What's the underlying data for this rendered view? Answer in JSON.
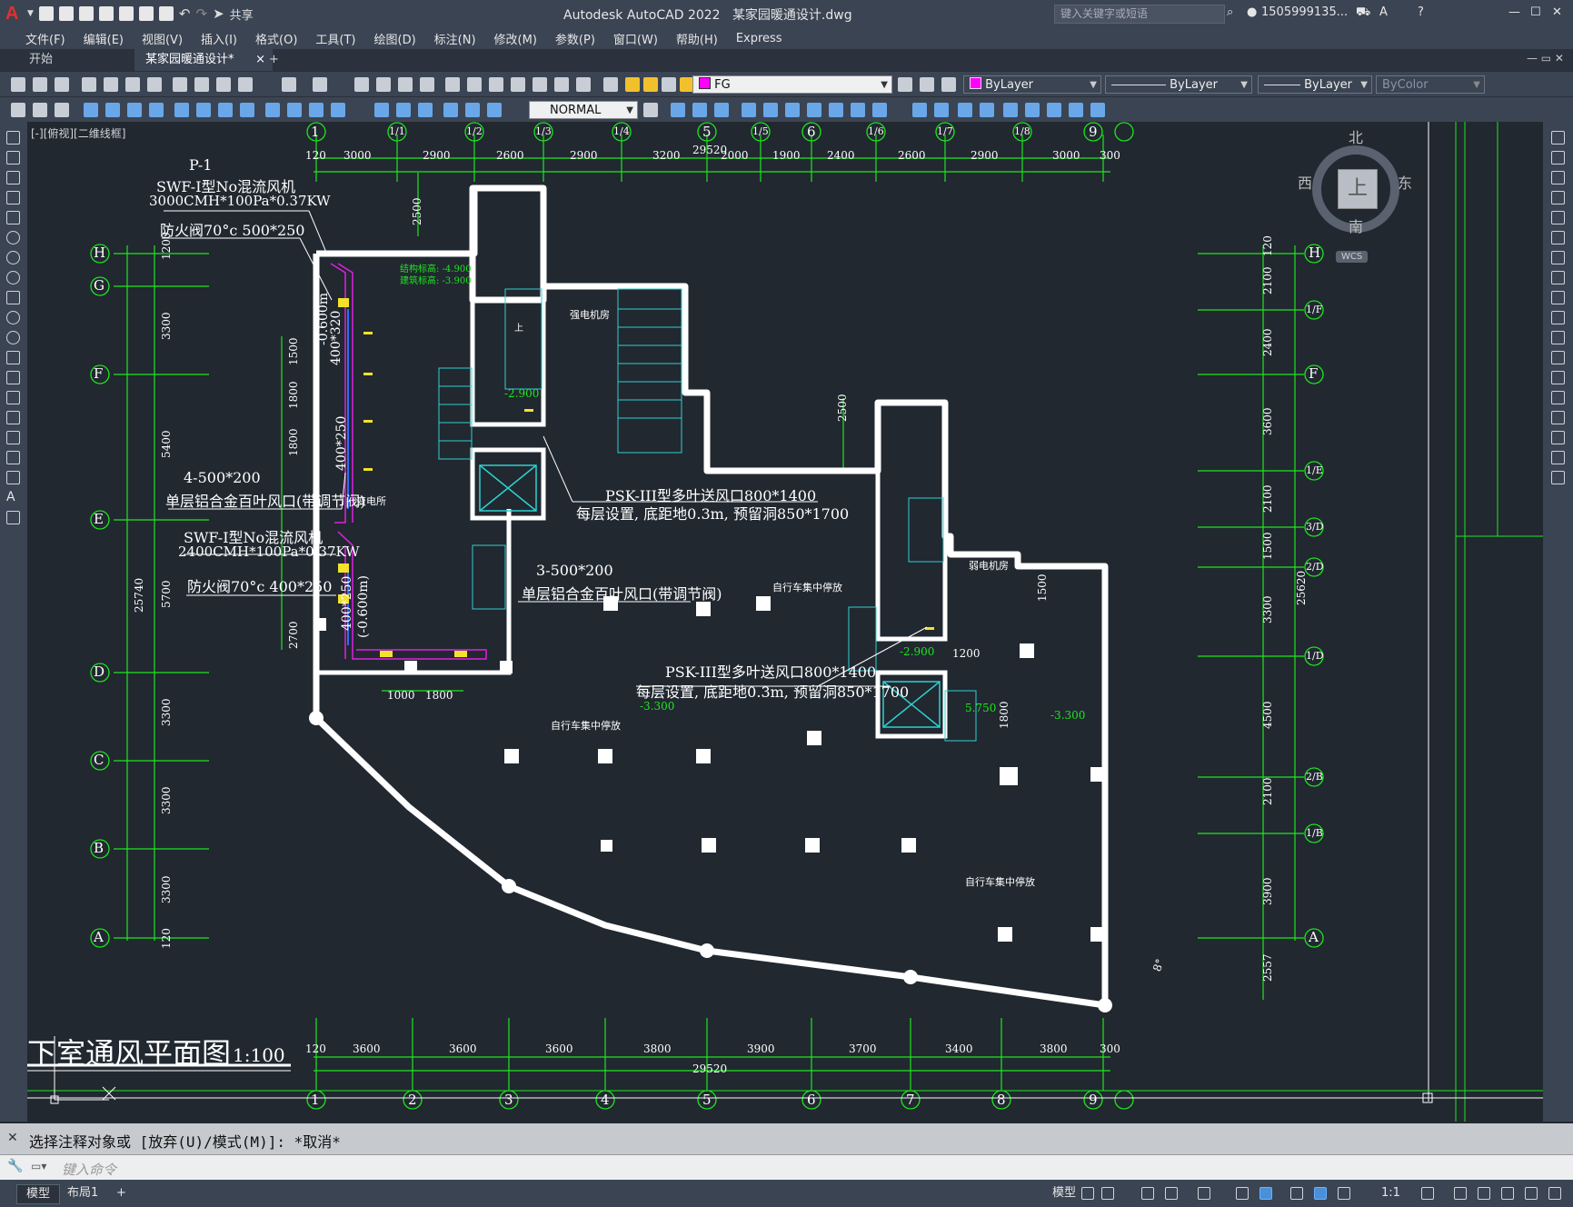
{
  "window": {
    "app_title": "Autodesk AutoCAD 2022",
    "file_name": "某家园暖通设计.dwg",
    "search_placeholder": "键入关键字或短语",
    "user": "1505999135...",
    "share_label": "共享"
  },
  "menu": [
    "文件(F)",
    "编辑(E)",
    "视图(V)",
    "插入(I)",
    "格式(O)",
    "工具(T)",
    "绘图(D)",
    "标注(N)",
    "修改(M)",
    "参数(P)",
    "窗口(W)",
    "帮助(H)",
    "Express"
  ],
  "tabs": {
    "start": "开始",
    "active": "某家园暖通设计*",
    "close": "×",
    "add": "+"
  },
  "toolbar": {
    "layer": "FG",
    "color": "ByLayer",
    "linetype": "ByLayer",
    "lineweight": "ByLayer",
    "plotstyle": "ByColor",
    "dimstyle": "NORMAL"
  },
  "viewport": {
    "label": "[-][俯视][二维线框]"
  },
  "viewcube": {
    "north": "北",
    "south": "南",
    "east": "东",
    "west": "西",
    "top": "上",
    "wcs": "WCS"
  },
  "drawing": {
    "title": "下室通风平面图",
    "scale": "1:100",
    "top_axes": [
      "1",
      "1/1",
      "1/2",
      "1/3",
      "1/4",
      "5",
      "1/5",
      "6",
      "1/6",
      "1/7",
      "1/8",
      "9"
    ],
    "top_dims": [
      "120",
      "3000",
      "2900",
      "2600",
      "2900",
      "3200",
      "2000",
      "1900",
      "2400",
      "2600",
      "2900",
      "3000",
      "300"
    ],
    "top_total": "29520",
    "bottom_axes": [
      "1",
      "2",
      "3",
      "4",
      "5",
      "6",
      "7",
      "8",
      "9"
    ],
    "bottom_dims": [
      "120",
      "3600",
      "3600",
      "3600",
      "3800",
      "3900",
      "3700",
      "3400",
      "3800",
      "300"
    ],
    "bottom_total": "29520",
    "left_axes": [
      "H",
      "G",
      "F",
      "E",
      "D",
      "C",
      "B",
      "A"
    ],
    "left_dims": [
      "1200",
      "3300",
      "5400",
      "5700",
      "3300",
      "3300",
      "3300",
      "120"
    ],
    "left_total": "25740",
    "left_inner_dims": [
      "1500",
      "1800",
      "1800",
      "2700"
    ],
    "right_axes": [
      "H",
      "1/F",
      "F",
      "1/E",
      "3/D",
      "2/D",
      "1/D",
      "2/B",
      "1/B",
      "A"
    ],
    "right_dims": [
      "120",
      "2100",
      "2400",
      "3600",
      "2100",
      "1500",
      "3300",
      "4500",
      "2100",
      "3900",
      "2557"
    ],
    "right_total": "25620",
    "notes": {
      "p1": "P-1",
      "fan1": "SWF-I型No混流风机",
      "fan1_spec": "3000CMH*100Pa*0.37KW",
      "fd1": "防火阀70°c 500*250",
      "grille1": "4-500*200",
      "grille1_desc": "单层铝合金百叶风口(带调节阀)",
      "fan2": "SWF-I型No混流风机",
      "fan2_spec": "2400CMH*100Pa*0.37KW",
      "fd2": "防火阀70°c 400*250",
      "grille2": "3-500*200",
      "grille2_desc": "单层铝合金百叶风口(带调节阀)",
      "psk1": "PSK-III型多叶送风口800*1400",
      "psk1_desc": "每层设置, 底距地0.3m, 预留洞850*1700",
      "psk2": "PSK-III型多叶送风口800*1400",
      "psk2_desc": "每层设置, 底距地0.3m, 预留洞850*1700",
      "duct1": "400*320",
      "duct1_h": "-0.600m",
      "duct2": "400*250",
      "duct3": "400*250",
      "duct3_h": "(-0.600m)",
      "elev_a": "结构标高: -4.900",
      "elev_b": "建筑标高: -3.900",
      "lv1": "-2.900",
      "lv2": "-2.900",
      "lv3": "-3.300",
      "lv4": "-3.300",
      "lv5": "5.750",
      "room1": "强电机房",
      "room2": "弱电机房",
      "room3": "变电所",
      "bike1": "自行车集中停放",
      "bike2": "自行车集中停放",
      "bike3": "自行车集中停放",
      "d2500a": "2500",
      "d2500b": "2500",
      "d1500": "1500",
      "d1200": "1200",
      "d1800": "1800",
      "d1000": "1000",
      "d1800b": "1800",
      "up": "上",
      "eight": "8°"
    }
  },
  "command": {
    "history": "选择注释对象或 [放弃(U)/模式(M)]: *取消*",
    "placeholder": "键入命令"
  },
  "status": {
    "model_tab": "模型",
    "layout_tab": "布局1",
    "add": "+",
    "model_btn": "模型",
    "scale": "1:1"
  }
}
